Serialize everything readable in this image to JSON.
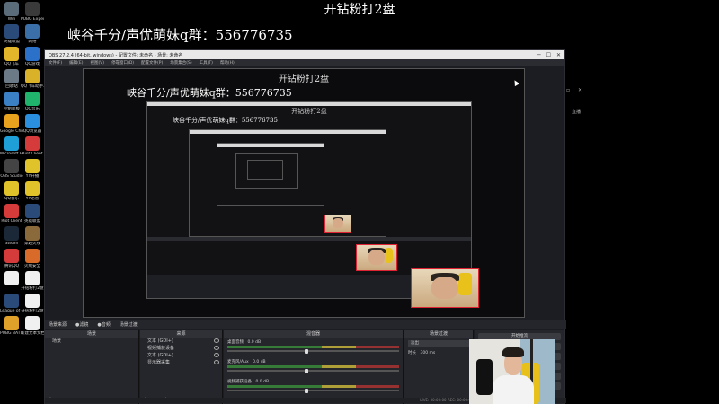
{
  "overlay": {
    "title": "开钻粉打2盘",
    "group_text": "峡谷千分/声优萌妹q群：556776735"
  },
  "desktop_icons": [
    {
      "label": "Win",
      "color": "#5a6b7a"
    },
    {
      "label": "PUBG Experience",
      "color": "#3a3a3a"
    },
    {
      "label": "英雄联盟",
      "color": "#2a4b7a"
    },
    {
      "label": "网络",
      "color": "#3a6fa8"
    },
    {
      "label": "QQ飞车",
      "color": "#e3b52a"
    },
    {
      "label": "QQ游戏",
      "color": "#2b70c9"
    },
    {
      "label": "回收站",
      "color": "#6b7a86"
    },
    {
      "label": "QQ飞车助手工具",
      "color": "#d9b22a"
    },
    {
      "label": "控制面板",
      "color": "#3b7fc4"
    },
    {
      "label": "QQ音乐",
      "color": "#1fb36b"
    },
    {
      "label": "Google Chrome",
      "color": "#e8a21e"
    },
    {
      "label": "QQ浏览器",
      "color": "#2b8fe0"
    },
    {
      "label": "Microsoft Edge",
      "color": "#1e9fd8"
    },
    {
      "label": "Riot Client",
      "color": "#d63b3b"
    },
    {
      "label": "OBS Studio",
      "color": "#444"
    },
    {
      "label": "YY开播",
      "color": "#e0c22a"
    },
    {
      "label": "QQ音乐",
      "color": "#e0c22a"
    },
    {
      "label": "YY语音",
      "color": "#e0c22a"
    },
    {
      "label": "Riot Client",
      "color": "#d63b3b"
    },
    {
      "label": "英雄联盟",
      "color": "#2a4b7a"
    },
    {
      "label": "Steam",
      "color": "#1b2838"
    },
    {
      "label": "穿越火线",
      "color": "#8a6a3a"
    },
    {
      "label": "腾讯QQ",
      "color": "#d63b3b"
    },
    {
      "label": "火绒安全",
      "color": "#d96b2a"
    },
    {
      "label": "",
      "color": "#f0f0f0"
    },
    {
      "label": "开钻粉打2盘",
      "color": "#f0f0f0"
    },
    {
      "label": "League of Legends",
      "color": "#2a4b7a"
    },
    {
      "label": "开钻粉打2盘",
      "color": "#f0f0f0"
    },
    {
      "label": "PUBG BATTLEGR",
      "color": "#e0a12a"
    },
    {
      "label": "新建文本文档",
      "color": "#f0f0f0"
    }
  ],
  "obs": {
    "title": "OBS 27.2.4 (64-bit, windows) - 配置文件: 未命名 - 场景: 未命名",
    "menu": [
      "文件(F)",
      "编辑(E)",
      "视图(V)",
      "停靠窗口(D)",
      "配置文件(P)",
      "场景集合(S)",
      "工具(T)",
      "帮助(H)"
    ],
    "docks_header": [
      "场景来源",
      "●滤镜",
      "●音频",
      "场景过渡"
    ],
    "scenes_header": "场景",
    "scenes": [
      "场景"
    ],
    "sources_header": "来源",
    "sources": [
      "文本 (GDI+)",
      "视频捕获设备",
      "文本 (GDI+)",
      "显示器采集"
    ],
    "mixer_header": "混音器",
    "mixer": [
      {
        "name": "桌面音频",
        "db": "0.0 dB"
      },
      {
        "name": "麦克风/Aux",
        "db": "0.0 dB"
      },
      {
        "name": "视频捕获设备",
        "db": "0.0 dB"
      }
    ],
    "transitions_header": "场景过渡",
    "transition_value": "淡出",
    "duration_label": "时长",
    "duration_value": "300 ms",
    "controls": [
      "开始推流",
      "开始录制",
      "启动虚拟摄像机",
      "工作室模式",
      "设置",
      "退出"
    ],
    "status": "LIVE: 00:00:00  REC: 00:00:00  CPU: 1.9%, 30.00 fps"
  },
  "preview_title": "开钻粉打2盘",
  "preview_group": "峡谷千分/声优萌妹q群：556776735",
  "nested_title": "开钻粉打2盘",
  "nested_group": "峡谷千分/声优萌妹q群：556776735",
  "side_label": "直播"
}
